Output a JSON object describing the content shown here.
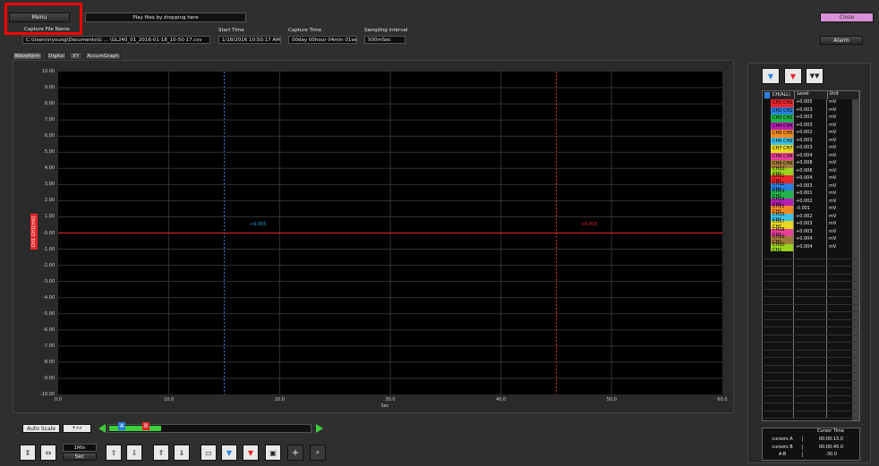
{
  "header": {
    "menu_label": "Menu",
    "drop_text": "Play files by dropping here",
    "close_label": "Close",
    "alarm_label": "Alarm"
  },
  "info": {
    "capture_file_label": "Capture File Name",
    "capture_file_value": "C:\\Users\\riyoung\\Documents\\G ... \\GL240_01_2016-01-18_10-50-17.csv",
    "start_time_label": "Start Time",
    "start_time_value": "1/18/2016 10:50:17 AM",
    "capture_time_label": "Capture Time",
    "capture_time_value": "00day 00hour 04min 01sec",
    "sampling_label": "Sampling interval",
    "sampling_value": "500mSec"
  },
  "tabs": [
    "Waveform",
    "Digital",
    "XY",
    "AccumGraph"
  ],
  "plot": {
    "y_axis_label": "CH1 CH1[mV]",
    "y_ticks": [
      "10.00",
      "9.00",
      "8.00",
      "7.00",
      "6.00",
      "5.00",
      "4.00",
      "3.00",
      "2.00",
      "1.00",
      "-0.00",
      "-1.00",
      "-2.00",
      "-3.00",
      "-4.00",
      "-5.00",
      "-6.00",
      "-7.00",
      "-8.00",
      "-9.00",
      "-10.00"
    ],
    "x_ticks": [
      "0.0",
      "10.0",
      "20.0",
      "30.0",
      "40.0",
      "50.0",
      "60.0"
    ],
    "x_axis_label": "Sec",
    "cursor_a_readout": "+0.005",
    "cursor_b_readout": "+0.005",
    "cursor_a_x": 15.0,
    "cursor_b_x": 45.0,
    "x_range": [
      0,
      60
    ],
    "y_range": [
      -10,
      10
    ],
    "trace_value": 0.0
  },
  "controls": {
    "auto_scale_label": "Auto Scale",
    "time_div_value": "1Min",
    "time_unit_value": "Sec",
    "cursor_a_marker": "A",
    "cursor_b_marker": "B"
  },
  "channel_table": {
    "header_ch": "CH(ALL)",
    "header_level": "Level",
    "header_unit": "Unit",
    "rows": [
      {
        "name": "CH1 CH1",
        "level": "+0.005",
        "unit": "mV",
        "color": "#e8252b"
      },
      {
        "name": "CH2 CH2",
        "level": "+0.003",
        "unit": "mV",
        "color": "#2a7fe0"
      },
      {
        "name": "CH3 CH3",
        "level": "+0.003",
        "unit": "mV",
        "color": "#22b34a"
      },
      {
        "name": "CH4 CH4",
        "level": "+0.003",
        "unit": "mV",
        "color": "#b51fb5"
      },
      {
        "name": "CH5 CH5",
        "level": "+0.002",
        "unit": "mV",
        "color": "#f08a1e"
      },
      {
        "name": "CH6 CH6",
        "level": "+0.003",
        "unit": "mV",
        "color": "#3fc0e8"
      },
      {
        "name": "CH7 CH7",
        "level": "+0.003",
        "unit": "mV",
        "color": "#e8d81e"
      },
      {
        "name": "CH8 CH8",
        "level": "+0.004",
        "unit": "mV",
        "color": "#e83f9a"
      },
      {
        "name": "CH9 CH9",
        "level": "+0.008",
        "unit": "mV",
        "color": "#a07a3a"
      },
      {
        "name": "CH10 CH1",
        "level": "+0.006",
        "unit": "mV",
        "color": "#9ad21e"
      },
      {
        "name": "CH11 CH1",
        "level": "+0.004",
        "unit": "mV",
        "color": "#e8252b"
      },
      {
        "name": "CH12 CH1",
        "level": "+0.003",
        "unit": "mV",
        "color": "#2a7fe0"
      },
      {
        "name": "CH13 CH1",
        "level": "+0.001",
        "unit": "mV",
        "color": "#22b34a"
      },
      {
        "name": "CH14 CH1",
        "level": "+0.002",
        "unit": "mV",
        "color": "#b51fb5"
      },
      {
        "name": "CH15 CH1",
        "level": "-0.001",
        "unit": "mV",
        "color": "#f08a1e"
      },
      {
        "name": "CH16 CH1",
        "level": "+0.002",
        "unit": "mV",
        "color": "#3fc0e8"
      },
      {
        "name": "CH17 CH1",
        "level": "+0.003",
        "unit": "mV",
        "color": "#e8d81e"
      },
      {
        "name": "CH18 CH1",
        "level": "+0.003",
        "unit": "mV",
        "color": "#e83f9a"
      },
      {
        "name": "CH19 CH1",
        "level": "+0.004",
        "unit": "mV",
        "color": "#a07a3a"
      },
      {
        "name": "CH20 CH2",
        "level": "+0.004",
        "unit": "mV",
        "color": "#9ad21e"
      }
    ]
  },
  "cursor_table": {
    "header": "Cursor Time",
    "rows": [
      {
        "label": "cursors A",
        "value": "00:00:15.0"
      },
      {
        "label": "cursors B",
        "value": "00:00:45.0"
      },
      {
        "label": "A-B",
        "value": "-30.0"
      }
    ]
  },
  "colors": {
    "highlight": "#ff0000",
    "close_button": "#d98fd9",
    "cursor_a": "#2a7fe0",
    "cursor_b": "#e8252b"
  }
}
